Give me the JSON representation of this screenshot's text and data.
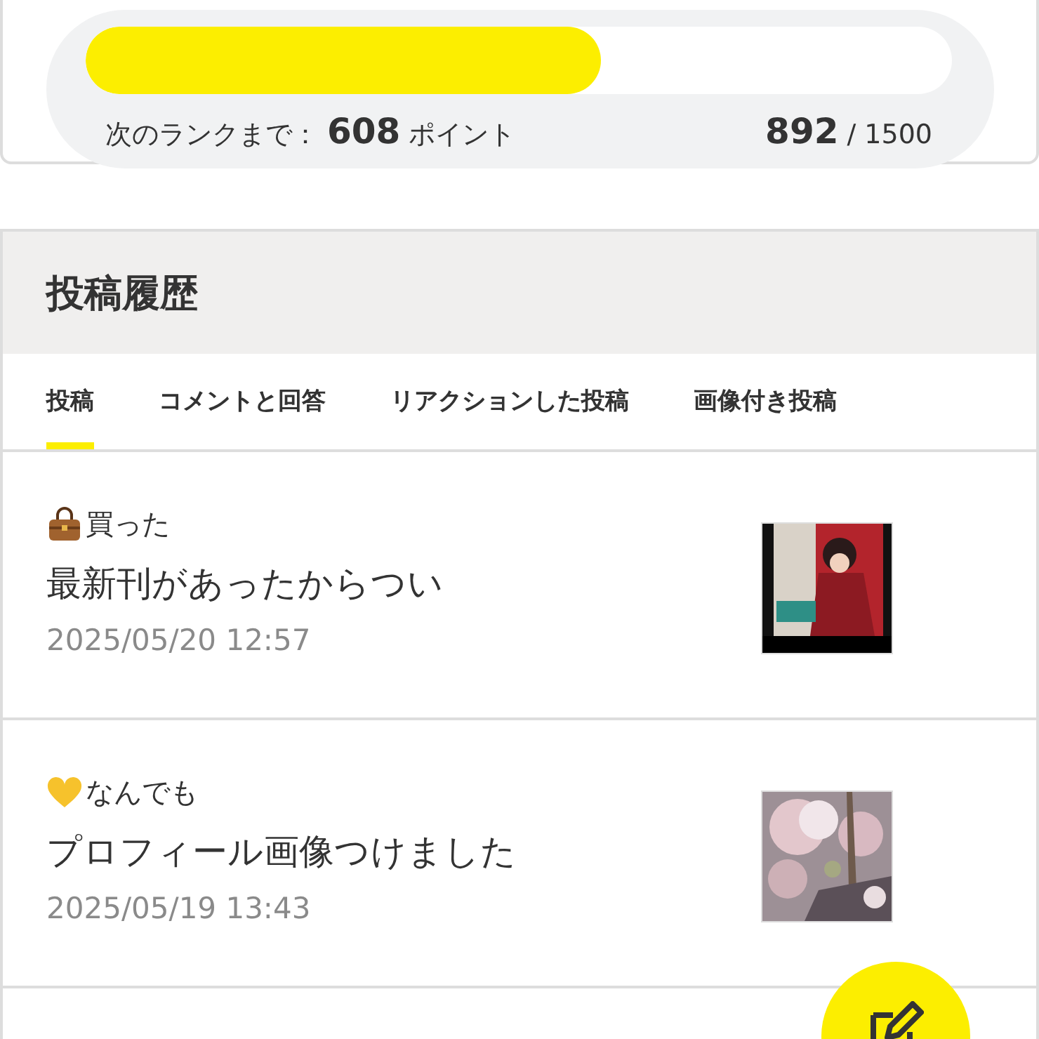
{
  "progress": {
    "level": 0.595,
    "label": "次のランクまで：",
    "remaining": "608",
    "unit": "ポイント",
    "current": "892",
    "separator": "/",
    "total": "1500"
  },
  "history": {
    "title": "投稿履歴",
    "tabs": [
      {
        "label": "投稿",
        "selected": true
      },
      {
        "label": "コメントと回答",
        "selected": false
      },
      {
        "label": "リアクションした投稿",
        "selected": false
      },
      {
        "label": "画像付き投稿",
        "selected": false
      }
    ],
    "posts": [
      {
        "category": {
          "kind": "bag",
          "label": "買った"
        },
        "title": "最新刊があったからつい",
        "date": "2025/05/20 12:57"
      },
      {
        "category": {
          "kind": "heart",
          "label": "なんでも"
        },
        "title": "プロフィール画像つけました",
        "date": "2025/05/19 13:43"
      }
    ]
  }
}
